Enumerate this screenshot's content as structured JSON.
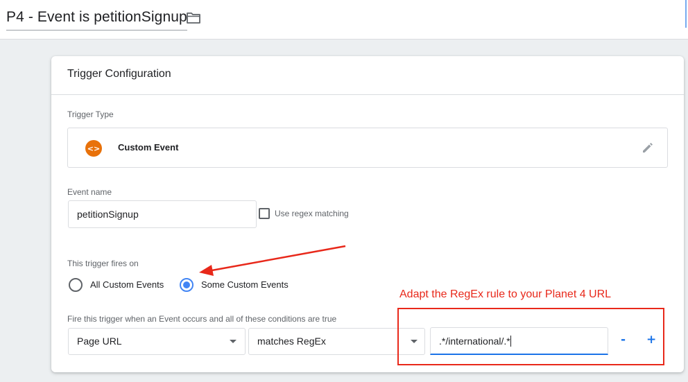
{
  "header": {
    "title": "P4 - Event is petitionSignup",
    "folder_icon": "folder-icon"
  },
  "card": {
    "title": "Trigger Configuration",
    "trigger_type": {
      "label": "Trigger Type",
      "icon": "custom-event-icon",
      "icon_glyph": "<>",
      "name": "Custom Event",
      "edit_icon": "pencil-icon"
    },
    "event_name": {
      "label": "Event name",
      "value": "petitionSignup",
      "regex_checkbox_label": "Use regex matching",
      "regex_checked": false
    },
    "fires_on": {
      "label": "This trigger fires on",
      "options": [
        {
          "label": "All Custom Events",
          "checked": false
        },
        {
          "label": "Some Custom Events",
          "checked": true
        }
      ]
    },
    "condition": {
      "label": "Fire this trigger when an Event occurs and all of these conditions are true",
      "variable": "Page URL",
      "operator": "matches RegEx",
      "value": ".*/international/.*",
      "remove_label": "-",
      "add_label": "+"
    }
  },
  "annotation": {
    "text": "Adapt the RegEx rule to your Planet 4 URL",
    "color": "#e8281a"
  },
  "colors": {
    "accent": "#1a73e8",
    "radio": "#4285f4",
    "trigger_icon": "#e8710a"
  }
}
